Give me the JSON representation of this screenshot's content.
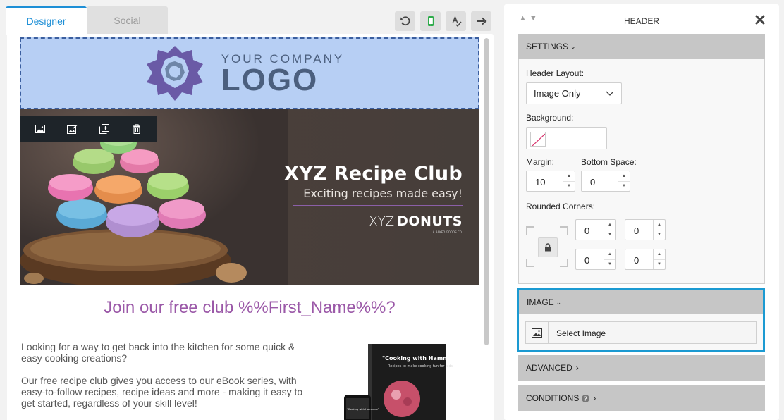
{
  "tabs": [
    {
      "label": "Designer",
      "active": true
    },
    {
      "label": "Social",
      "active": false
    }
  ],
  "toolbar": {
    "icons": [
      "undo-icon",
      "mobile-preview-icon",
      "spell-check-icon",
      "redo-icon"
    ],
    "mobile_color": "#2eab4b"
  },
  "email": {
    "logo": {
      "small": "YOUR COMPANY",
      "big": "LOGO"
    },
    "hero": {
      "title": "XYZ Recipe Club",
      "subtitle": "Exciting recipes made easy!",
      "brand_prefix": "XYZ",
      "brand_name": "DONUTS",
      "brand_tagline": "A BAKED GOODS CO."
    },
    "heading": "Join our free club %%First_Name%%?",
    "paragraphs": [
      "Looking for a way to get back into the kitchen for some quick & easy cooking creations?",
      "Our free recipe club gives you access to our eBook series, with easy-to-follow recipes, recipe ideas and more - making it easy to get started, regardless of your skill level!"
    ],
    "ebook": {
      "title": "\"Cooking with Hammers\"",
      "subtitle": "Recipes to make cooking fun for kids",
      "phone_title": "\"Cooking with Hammers\""
    }
  },
  "panel": {
    "title": "HEADER",
    "settings": {
      "label": "SETTINGS",
      "header_layout_label": "Header Layout:",
      "header_layout_value": "Image Only",
      "background_label": "Background:",
      "margin_label": "Margin:",
      "margin_value": "10",
      "bottom_space_label": "Bottom Space:",
      "bottom_space_value": "0",
      "rounded_corners_label": "Rounded Corners:",
      "corners": [
        "0",
        "0",
        "0",
        "0"
      ]
    },
    "image": {
      "label": "IMAGE",
      "select_label": "Select Image"
    },
    "advanced": {
      "label": "ADVANCED"
    },
    "conditions": {
      "label": "CONDITIONS"
    }
  },
  "colors": {
    "accent": "#1e8fd6",
    "heading_purple": "#9b59a8",
    "selection_border": "#1b9ad2",
    "logo_bg": "#b7cff4"
  }
}
